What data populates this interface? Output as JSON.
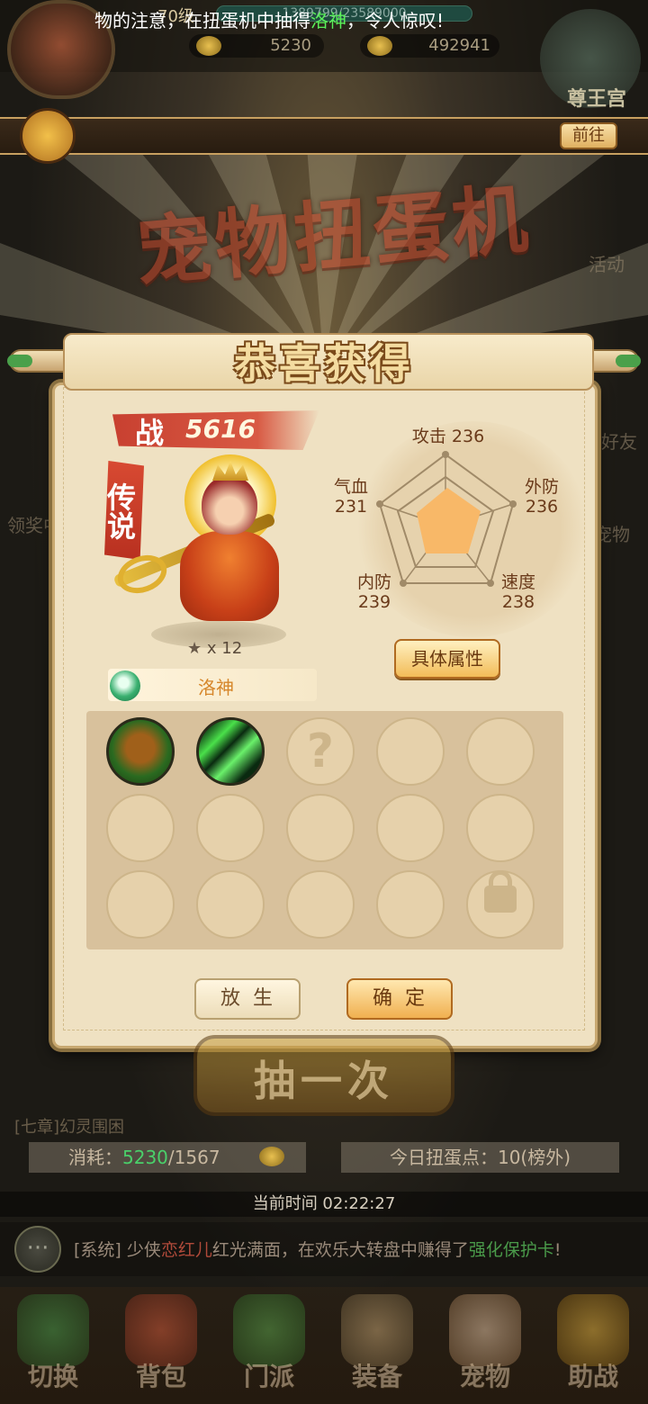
{
  "player": {
    "level": "70级",
    "xp": "1389799/23589000",
    "gold": "5230",
    "ingot": "492941"
  },
  "top_right": {
    "label": "尊王宫"
  },
  "broadcast": {
    "text_prefix": "物的注意，在扭蛋机中抽得",
    "highlight": "洛神",
    "text_suffix": "，令人惊叹!",
    "goto_label": "前往"
  },
  "side_items": {
    "left_label": "领奖中",
    "right_activity": "活动",
    "right_friend": "好友",
    "right_pet": "宠物"
  },
  "machine_title": "宠物扭蛋机",
  "dialog": {
    "title": "恭喜获得",
    "power_label": "战",
    "power_value": "5616",
    "rarity": "传说",
    "stars": "x 12",
    "pet_name": "洛神",
    "detail_button": "具体属性",
    "release_button": "放生",
    "confirm_button": "确定"
  },
  "stats": {
    "attack": {
      "label": "攻击",
      "value": "236"
    },
    "hp": {
      "label": "气血",
      "value": "231"
    },
    "outer_def": {
      "label": "外防",
      "value": "236"
    },
    "inner_def": {
      "label": "内防",
      "value": "239"
    },
    "speed": {
      "label": "速度",
      "value": "238"
    }
  },
  "skills": [
    "mushroom-skill",
    "wind-slash-skill",
    "unknown",
    "empty",
    "empty",
    "empty",
    "empty",
    "empty",
    "empty",
    "empty",
    "empty",
    "empty",
    "empty",
    "empty",
    "locked"
  ],
  "draw": {
    "button": "抽一次",
    "chapter": "[七章]幻灵围困",
    "cost_label": "消耗：",
    "cost_value": "5230",
    "cost_total": "/1567",
    "points": "今日扭蛋点：10(榜外)",
    "current_time": "当前时间 02:22:27"
  },
  "system_chat": {
    "prefix": "[系统] 少侠",
    "name": "恋红儿",
    "mid": "红光满面，在欢乐大转盘中赚得了",
    "item": "强化保护卡",
    "end": "!"
  },
  "nav": [
    {
      "label": "切换"
    },
    {
      "label": "背包"
    },
    {
      "label": "门派"
    },
    {
      "label": "装备"
    },
    {
      "label": "宠物"
    },
    {
      "label": "助战"
    }
  ],
  "colors": {
    "accent": "#f0b050",
    "highlight_green": "#5af05a",
    "legend_red": "#d84a32",
    "radar_fill": "#f8b868"
  }
}
